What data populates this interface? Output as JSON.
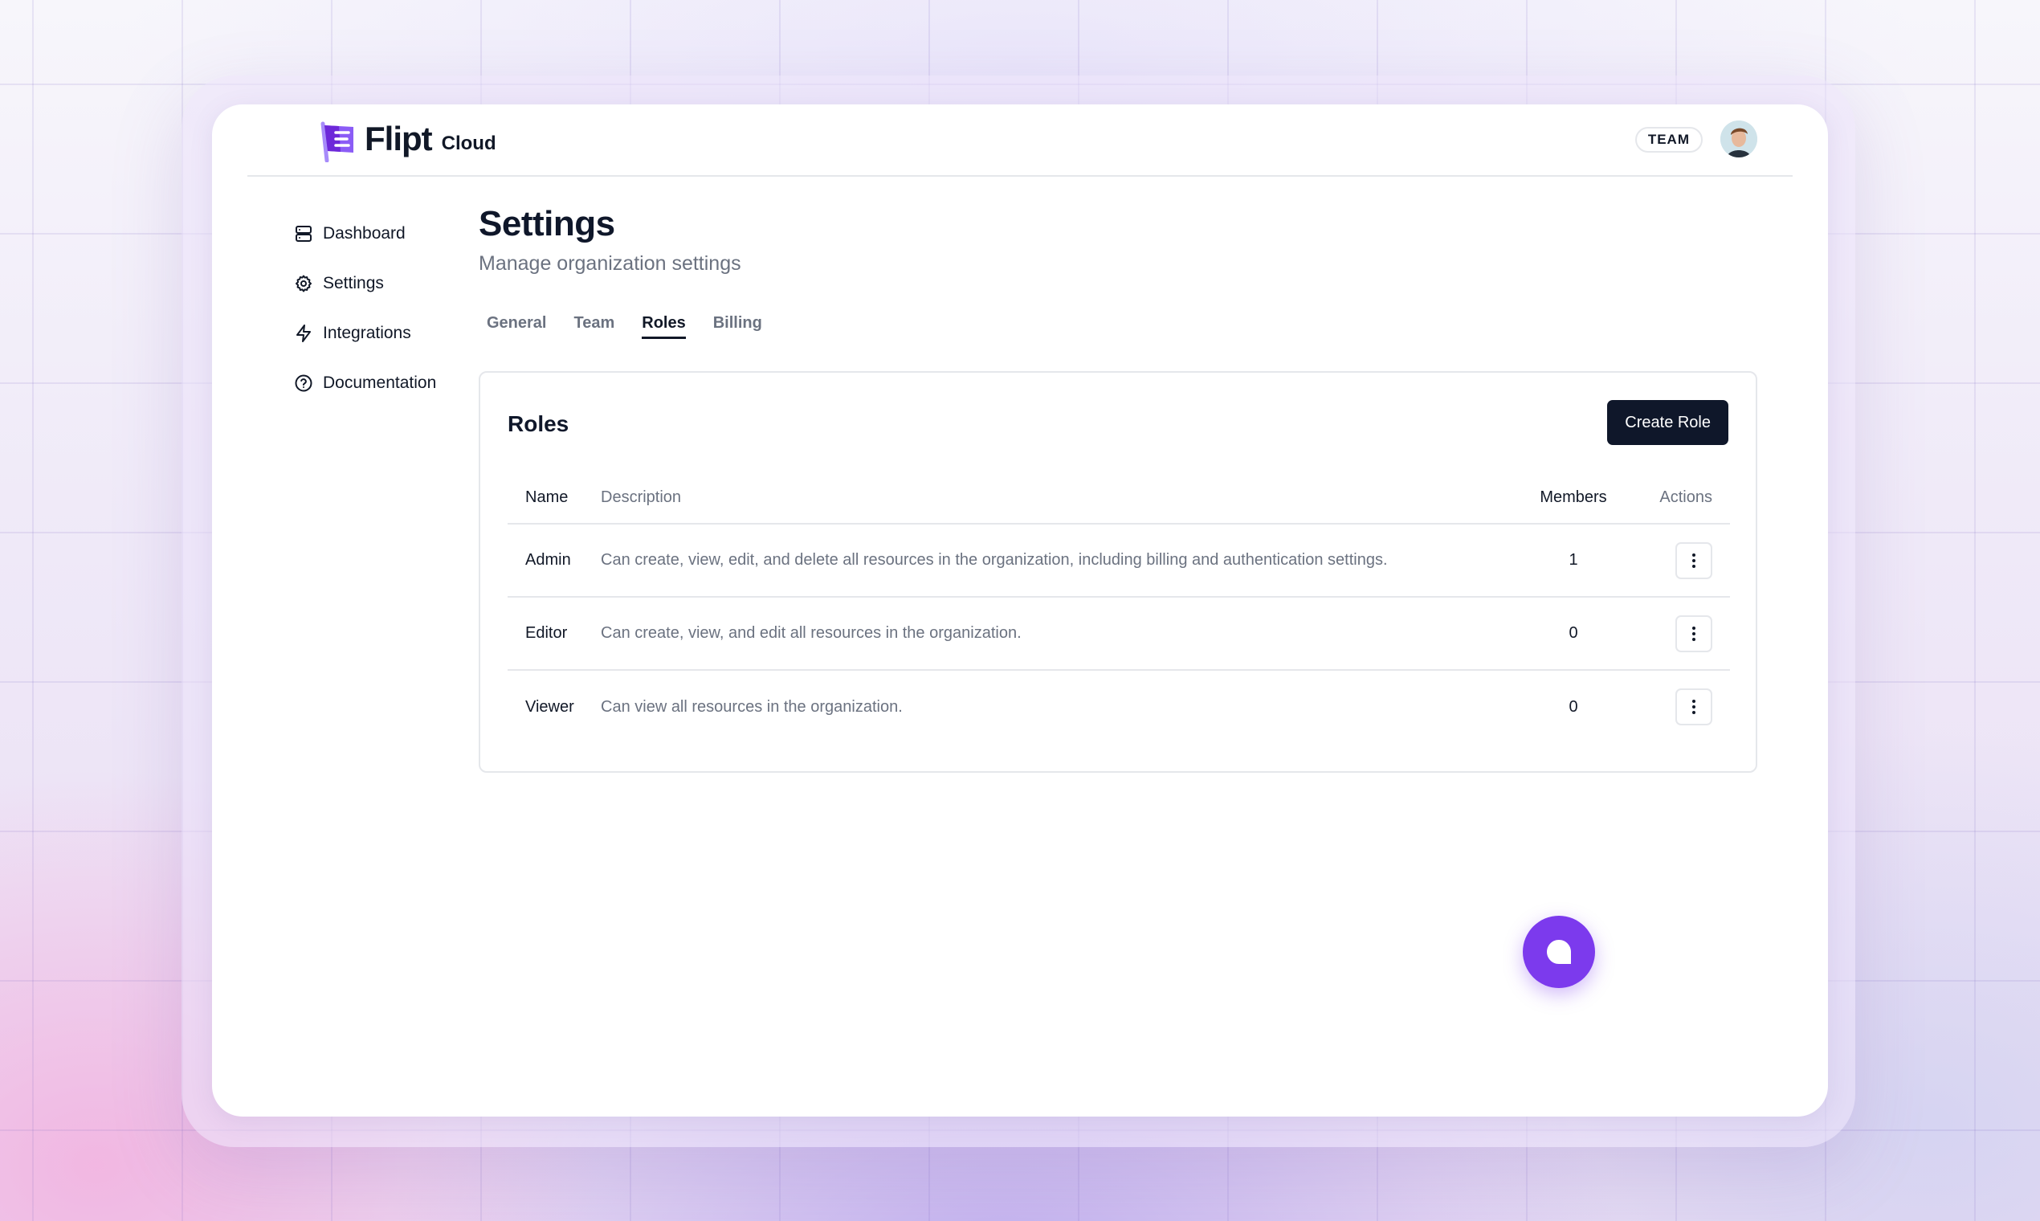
{
  "brand": {
    "name": "Flipt",
    "product": "Cloud"
  },
  "header": {
    "plan_badge": "TEAM"
  },
  "sidebar": {
    "items": [
      {
        "label": "Dashboard",
        "icon": "server-icon"
      },
      {
        "label": "Settings",
        "icon": "gear-icon"
      },
      {
        "label": "Integrations",
        "icon": "bolt-icon"
      },
      {
        "label": "Documentation",
        "icon": "help-circle-icon"
      }
    ]
  },
  "page": {
    "title": "Settings",
    "subtitle": "Manage organization settings",
    "tabs": [
      {
        "label": "General",
        "active": false
      },
      {
        "label": "Team",
        "active": false
      },
      {
        "label": "Roles",
        "active": true
      },
      {
        "label": "Billing",
        "active": false
      }
    ]
  },
  "roles": {
    "title": "Roles",
    "create_label": "Create Role",
    "columns": {
      "name": "Name",
      "description": "Description",
      "members": "Members",
      "actions": "Actions"
    },
    "rows": [
      {
        "name": "Admin",
        "description": "Can create, view, edit, and delete all resources in the organization, including billing and authentication settings.",
        "members": "1"
      },
      {
        "name": "Editor",
        "description": "Can create, view, and edit all resources in the organization.",
        "members": "0"
      },
      {
        "name": "Viewer",
        "description": "Can view all resources in the organization.",
        "members": "0"
      }
    ]
  },
  "colors": {
    "accent": "#7c3aed",
    "primary_button": "#0f172a",
    "muted_text": "#6b7280"
  },
  "chat": {
    "icon": "chat-bubble-icon"
  }
}
